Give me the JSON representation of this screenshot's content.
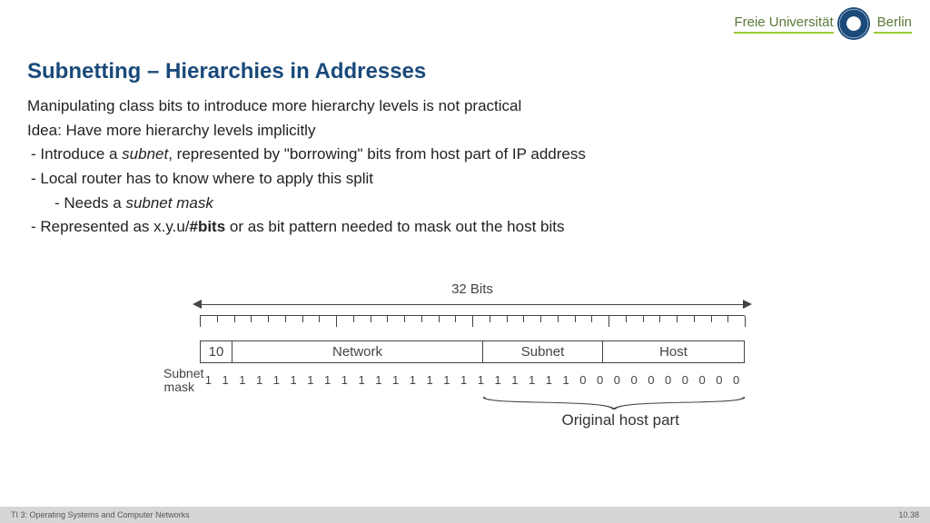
{
  "header": {
    "uni_left": "Freie Universität",
    "uni_right": "Berlin"
  },
  "title": "Subnetting – Hierarchies in Addresses",
  "content": {
    "p1": "Manipulating class bits to introduce more hierarchy levels is not practical",
    "p2": "Idea: Have more hierarchy levels implicitly",
    "b1_pre": "Introduce a ",
    "b1_em": "subnet",
    "b1_post": ", represented by \"borrowing\" bits from host part of IP address",
    "b2": "Local router has to know where to apply this split",
    "b2a_pre": "Needs a ",
    "b2a_em": "subnet mask",
    "b3_pre": "Represented as x.y.u/",
    "b3_bold": "#bits",
    "b3_post": " or as bit pattern needed to mask out the host bits"
  },
  "diagram": {
    "bits_label": "32 Bits",
    "mask_label": "Subnet\nmask",
    "box_10": "10",
    "box_net": "Network",
    "box_sub": "Subnet",
    "box_host": "Host",
    "mask_bits": [
      "1",
      "1",
      "1",
      "1",
      "1",
      "1",
      "1",
      "1",
      "1",
      "1",
      "1",
      "1",
      "1",
      "1",
      "1",
      "1",
      "1",
      "1",
      "1",
      "1",
      "1",
      "1",
      "0",
      "0",
      "0",
      "0",
      "0",
      "0",
      "0",
      "0",
      "0",
      "0"
    ],
    "orig_label": "Original host part"
  },
  "footer": {
    "left": "TI 3: Operating Systems and Computer Networks",
    "right": "10.38"
  }
}
